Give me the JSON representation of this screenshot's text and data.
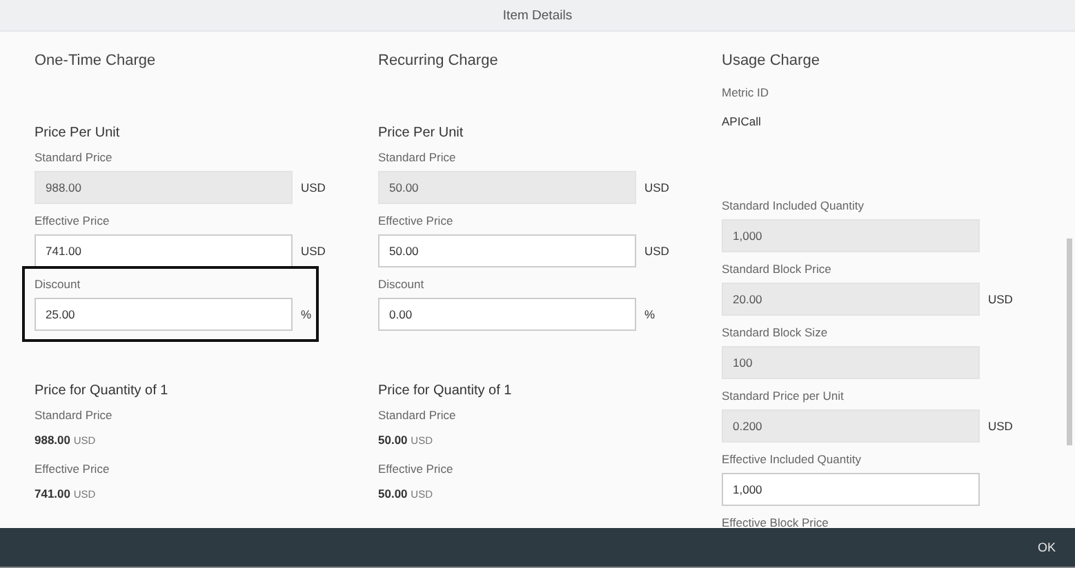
{
  "dialog": {
    "title": "Item Details"
  },
  "columns": [
    {
      "title": "One-Time Charge",
      "items": [
        {
          "kind": "subheading",
          "text": "Price Per Unit"
        },
        {
          "kind": "field",
          "label": "Standard Price",
          "value": "988.00",
          "unit": "USD",
          "disabled": true,
          "highlighted": false
        },
        {
          "kind": "field",
          "label": "Effective Price",
          "value": "741.00",
          "unit": "USD",
          "disabled": false,
          "highlighted": false
        },
        {
          "kind": "field",
          "label": "Discount",
          "value": "25.00",
          "unit": "%",
          "disabled": false,
          "highlighted": true
        },
        {
          "kind": "subheading",
          "text": "Price for Quantity of 1"
        },
        {
          "kind": "readout",
          "label": "Standard Price",
          "value": "988.00",
          "unit": "USD"
        },
        {
          "kind": "readout",
          "label": "Effective Price",
          "value": "741.00",
          "unit": "USD"
        }
      ]
    },
    {
      "title": "Recurring Charge",
      "items": [
        {
          "kind": "subheading",
          "text": "Price Per Unit"
        },
        {
          "kind": "field",
          "label": "Standard Price",
          "value": "50.00",
          "unit": "USD",
          "disabled": true,
          "highlighted": false
        },
        {
          "kind": "field",
          "label": "Effective Price",
          "value": "50.00",
          "unit": "USD",
          "disabled": false,
          "highlighted": false
        },
        {
          "kind": "field",
          "label": "Discount",
          "value": "0.00",
          "unit": "%",
          "disabled": false,
          "highlighted": false
        },
        {
          "kind": "subheading",
          "text": "Price for Quantity of 1"
        },
        {
          "kind": "readout",
          "label": "Standard Price",
          "value": "50.00",
          "unit": "USD"
        },
        {
          "kind": "readout",
          "label": "Effective Price",
          "value": "50.00",
          "unit": "USD"
        }
      ]
    },
    {
      "title": "Usage Charge",
      "items": [
        {
          "kind": "info",
          "label": "Metric ID",
          "value": "APICall"
        },
        {
          "kind": "field",
          "label": "Standard Included Quantity",
          "value": "1,000",
          "disabled": true,
          "highlighted": false
        },
        {
          "kind": "field",
          "label": "Standard Block Price",
          "value": "20.00",
          "unit": "USD",
          "disabled": true,
          "highlighted": false
        },
        {
          "kind": "field",
          "label": "Standard Block Size",
          "value": "100",
          "disabled": true,
          "highlighted": false
        },
        {
          "kind": "field",
          "label": "Standard Price per Unit",
          "value": "0.200",
          "unit": "USD",
          "disabled": true,
          "highlighted": false
        },
        {
          "kind": "field",
          "label": "Effective Included Quantity",
          "value": "1,000",
          "disabled": false,
          "highlighted": false
        },
        {
          "kind": "label",
          "text": "Effective Block Price"
        }
      ]
    }
  ],
  "footer": {
    "button": "OK"
  }
}
